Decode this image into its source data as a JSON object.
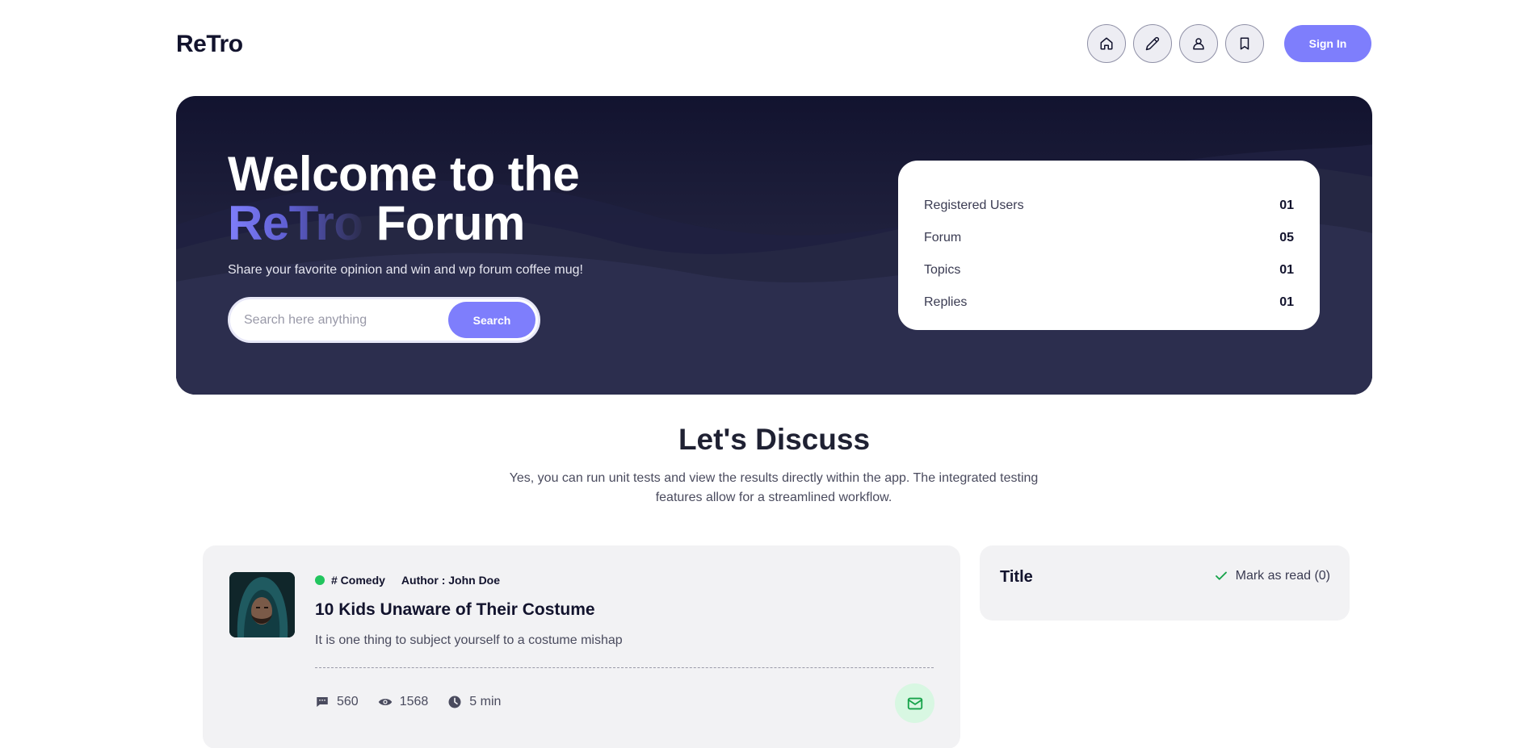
{
  "header": {
    "logo": "ReTro",
    "nav": [
      {
        "name": "home",
        "icon": "home-icon"
      },
      {
        "name": "write",
        "icon": "pencil-icon"
      },
      {
        "name": "profile",
        "icon": "user-icon"
      },
      {
        "name": "bookmarks",
        "icon": "bookmark-icon"
      }
    ],
    "signin_label": "Sign In"
  },
  "hero": {
    "title_line1": "Welcome to the",
    "title_brand": "ReTro",
    "title_rest": "Forum",
    "subtitle": "Share your favorite opinion and win and wp forum coffee mug!",
    "search": {
      "placeholder": "Search here anything",
      "value": "",
      "button_label": "Search"
    },
    "stats": [
      {
        "label": "Registered Users",
        "value": "01"
      },
      {
        "label": "Forum",
        "value": "05"
      },
      {
        "label": "Topics",
        "value": "01"
      },
      {
        "label": "Replies",
        "value": "01"
      }
    ]
  },
  "discuss": {
    "title": "Let's Discuss",
    "description": "Yes, you can run unit tests and view the results directly within the app. The integrated testing features allow for a streamlined workflow."
  },
  "posts": [
    {
      "category": "# Comedy",
      "author": "Author : John Doe",
      "title": "10 Kids Unaware of Their Costume",
      "excerpt": "It is one thing to subject yourself to a costume mishap",
      "comments": "560",
      "views": "1568",
      "read_time": "5 min",
      "status_color": "#22c55e"
    }
  ],
  "sidebar": {
    "title": "Title",
    "mark_read_label": "Mark as read (0)"
  },
  "colors": {
    "accent": "#7e7efc",
    "hero_bg": "#12132f",
    "online": "#22c55e"
  }
}
